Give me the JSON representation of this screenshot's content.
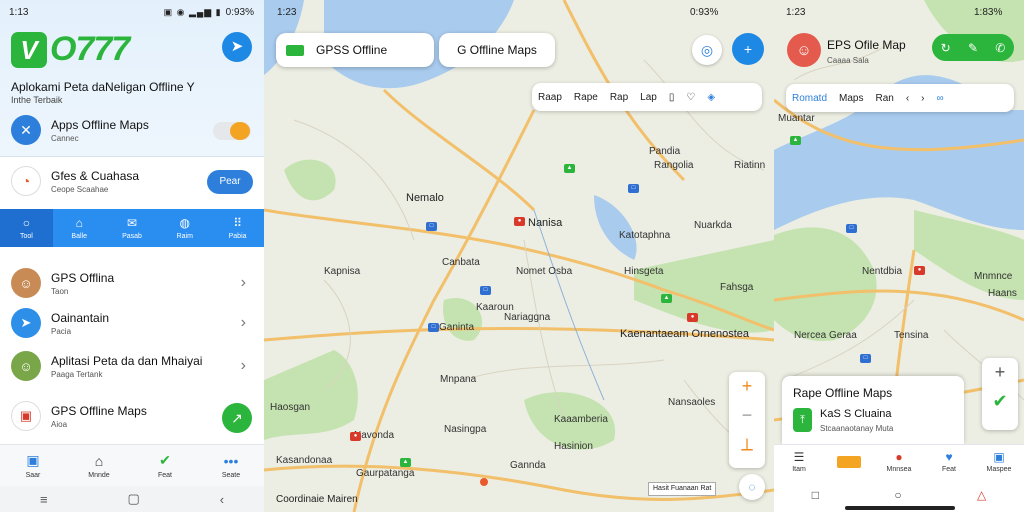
{
  "panel1": {
    "status": {
      "time": "1:13",
      "right": "0:93%",
      "icons": "▣ ◉ ▂▄▆ ▮"
    },
    "logo": {
      "letter": "V",
      "text": "O777"
    },
    "title": "Aplokami Peta daNeligan Offline Y",
    "subtitle": "Inthe Terbaik",
    "rows": [
      {
        "title": "Apps Offline Maps",
        "sub": "Cannec",
        "icon": "wrench-icon"
      },
      {
        "title": "Gfes & Cuahasa",
        "sub": "Ceope Scaahae",
        "icon": "logo-icon"
      }
    ],
    "pill_button": "Pear",
    "tabs": [
      {
        "label": "Tool",
        "icon": "search-icon"
      },
      {
        "label": "Balle",
        "icon": "home-icon"
      },
      {
        "label": "Pasab",
        "icon": "mail-icon"
      },
      {
        "label": "Raim",
        "icon": "chat-icon"
      },
      {
        "label": "Pabia",
        "icon": "grid-icon"
      }
    ],
    "list": [
      {
        "title": "GPS Offlina",
        "sub": "Taon"
      },
      {
        "title": "Oainantain",
        "sub": "Pacia"
      },
      {
        "title": "Aplitasi Peta da dan Mhaiyai",
        "sub": "Paaga Tertank"
      },
      {
        "title": "GPS Offline Maps",
        "sub": "Aioa"
      }
    ],
    "bottom_nav": [
      {
        "label": "Saar",
        "icon": "square-icon"
      },
      {
        "label": "Mnnde",
        "icon": "home-icon"
      },
      {
        "label": "Feat",
        "icon": "route-icon"
      },
      {
        "label": "Seate",
        "icon": "dots-icon"
      }
    ]
  },
  "panel2": {
    "status": {
      "time": "1:23",
      "right": "0:93%"
    },
    "search_card": "GPSS Offline",
    "second_card": "G Offline Maps",
    "chips": [
      "Raap",
      "Rape",
      "Rap",
      "Lap"
    ],
    "labels": [
      "Nemalo",
      "Pandia",
      "Canbata",
      "Nanisa",
      "Kaaroun",
      "Nomet Osba",
      "Hinsgeta",
      "Fahsga",
      "Mnpana",
      "Nansaoles",
      "Kaaamberia",
      "Kasandonaa",
      "Navonda",
      "Gaurpatanga",
      "Nasingpa",
      "Gannda",
      "Hasinion",
      "Nariaggna",
      "Riatinn",
      "Kapnisa",
      "Katotaphna",
      "Rangolia",
      "Haosgan",
      "Nuarkda",
      "Ganinta",
      "Kaenantaeam Ornenostea"
    ],
    "scale": "Hasit Fuanaan  Rat",
    "attribution": "Coordinaie Mairen"
  },
  "panel3": {
    "status": {
      "time": "1:23",
      "right": "1:83%"
    },
    "title": "EPS Ofile Map",
    "sub": "Caaaa Sala",
    "chips": [
      "Romatd",
      "Maps",
      "Ran"
    ],
    "labels": [
      "Muantar",
      "Mnmnce",
      "Nentdbia",
      "Nercea Geraa",
      "Haans",
      "Tensina"
    ],
    "sheet": {
      "title": "Rape Offline Maps",
      "name": "KaS S Cluaina",
      "sub": "Stcaanaotanay Muta"
    },
    "bottom_nav": [
      {
        "label": "Itam",
        "icon": "menu-icon"
      },
      {
        "label": "Mnnsea",
        "icon": "location-icon"
      },
      {
        "label": "Feat",
        "icon": "heart-icon"
      },
      {
        "label": "Maspee",
        "icon": "bookmark-icon"
      }
    ]
  },
  "colors": {
    "accent_blue": "#2d7fdb",
    "brand_green": "#2bb53c",
    "water": "#a9cbee",
    "road": "#f2bf6a",
    "park": "#c5e3b0"
  }
}
